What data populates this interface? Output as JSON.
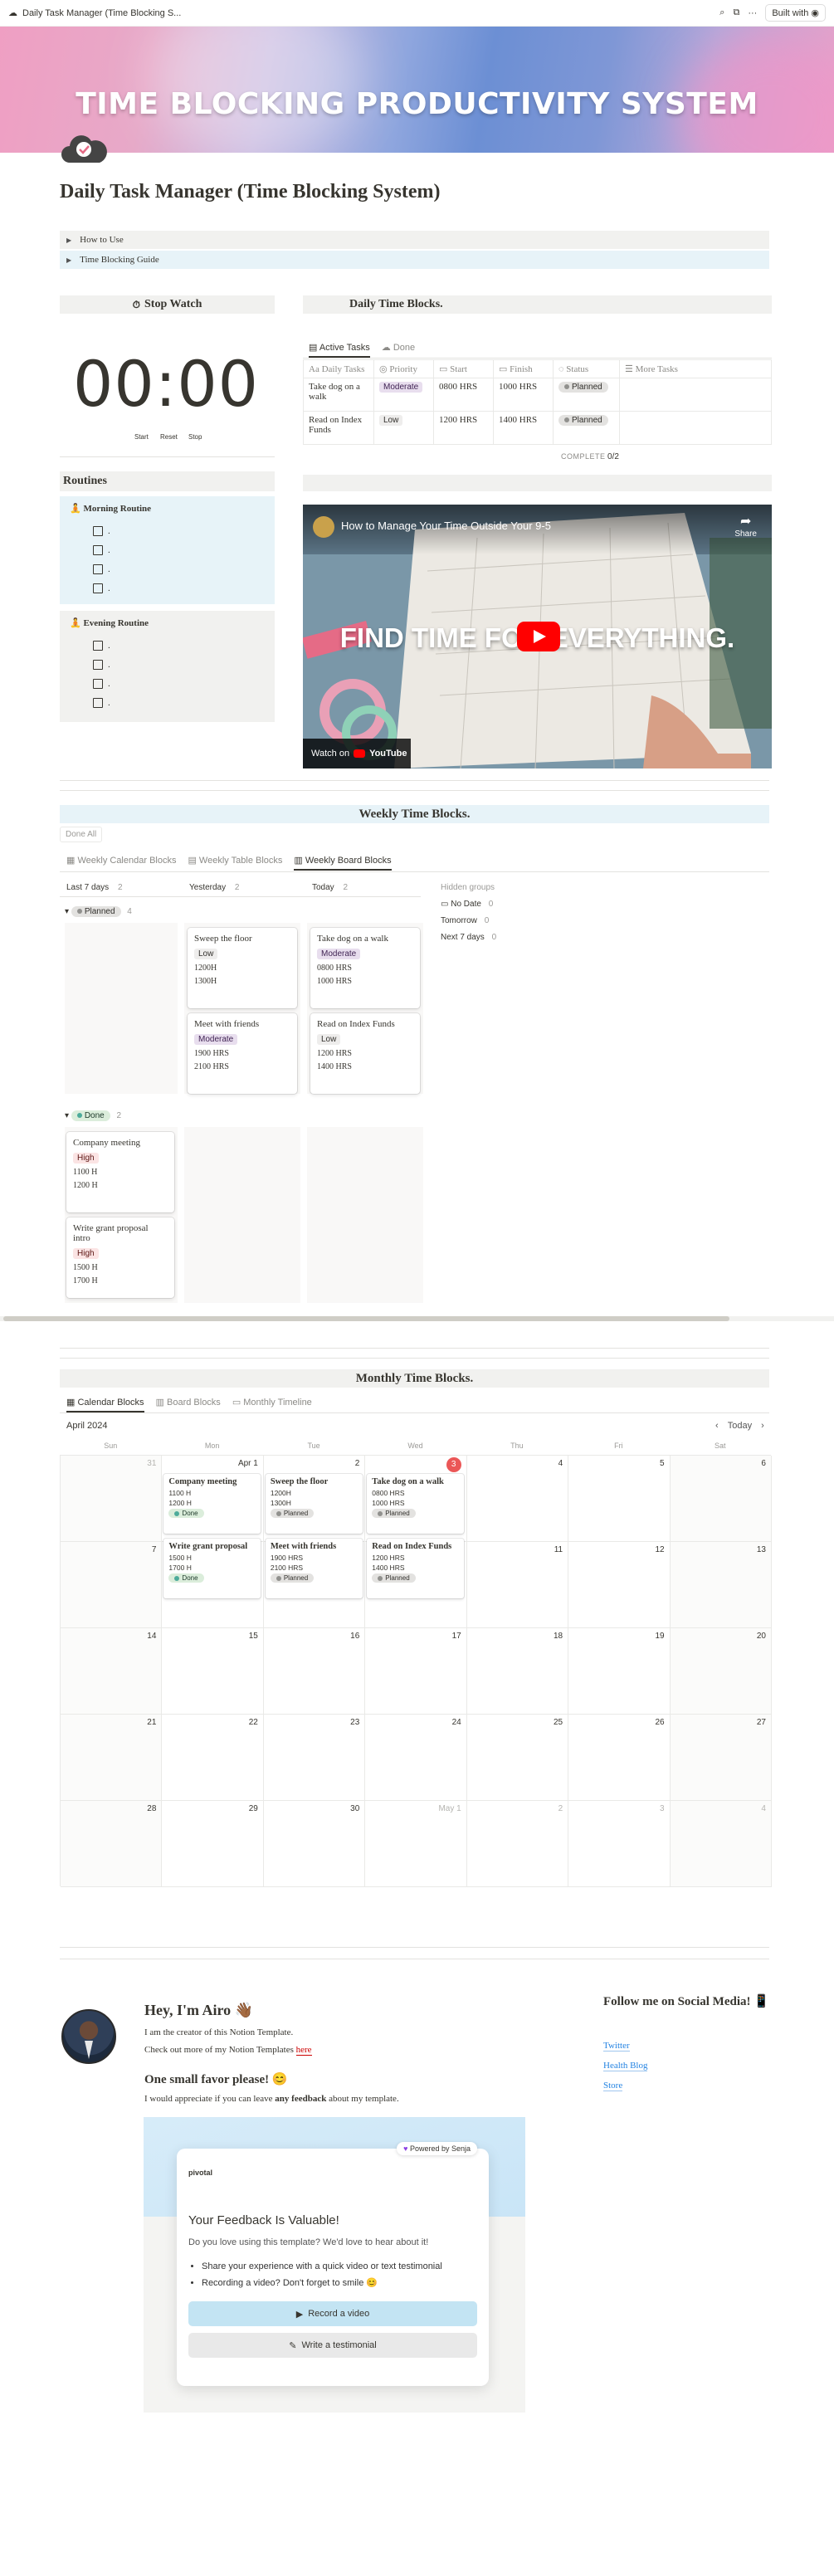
{
  "topbar": {
    "tab_title": "Daily Task Manager (Time Blocking S...",
    "built_with": "Built with"
  },
  "cover": {
    "title": "TIME BLOCKING PRODUCTIVITY SYSTEM"
  },
  "page": {
    "title": "Daily Task Manager (Time Blocking System)"
  },
  "toggles": [
    "How to Use",
    "Time Blocking Guide"
  ],
  "stopwatch": {
    "header": "Stop Watch",
    "time": "00:00",
    "start": "Start",
    "reset": "Reset",
    "stop": "Stop"
  },
  "daily": {
    "header": "Daily Time Blocks.",
    "tab_active": "Active Tasks",
    "tab_done": "Done",
    "columns": [
      "Daily Tasks",
      "Priority",
      "Start",
      "Finish",
      "Status",
      "More Tasks"
    ],
    "rows": [
      {
        "task": "Take dog on a walk",
        "priority": "Moderate",
        "start": "0800 HRS",
        "finish": "1000 HRS",
        "status": "Planned"
      },
      {
        "task": "Read on Index Funds",
        "priority": "Low",
        "start": "1200 HRS",
        "finish": "1400 HRS",
        "status": "Planned"
      }
    ],
    "count_label": "COMPLETE",
    "count_value": "0/2"
  },
  "routines": {
    "header": "Routines",
    "morning": "Morning Routine",
    "evening": "Evening Routine",
    "placeholder": "."
  },
  "video": {
    "title": "How to Manage Your Time Outside Your 9-5",
    "share": "Share",
    "overlay": "FIND TIME FOR EVERYTHING.",
    "watch_on": "Watch on",
    "youtube": "YouTube"
  },
  "weekly": {
    "header": "Weekly Time Blocks.",
    "done_all": "Done All",
    "tabs": [
      "Weekly Calendar Blocks",
      "Weekly Table Blocks",
      "Weekly Board Blocks"
    ],
    "columns": [
      {
        "label": "Last 7 days",
        "count": "2"
      },
      {
        "label": "Yesterday",
        "count": "2"
      },
      {
        "label": "Today",
        "count": "2"
      }
    ],
    "hidden": {
      "title": "Hidden groups",
      "items": [
        {
          "label": "No Date",
          "count": "0"
        },
        {
          "label": "Tomorrow",
          "count": "0"
        },
        {
          "label": "Next 7 days",
          "count": "0"
        }
      ]
    },
    "group_planned": {
      "label": "Planned",
      "count": "4"
    },
    "group_done": {
      "label": "Done",
      "count": "2"
    },
    "cards_planned": [
      {
        "name": "Sweep the floor",
        "priority": "Low",
        "start": "1200H",
        "finish": "1300H"
      },
      {
        "name": "Meet with friends",
        "priority": "Moderate",
        "start": "1900 HRS",
        "finish": "2100 HRS"
      },
      {
        "name": "Take dog on a walk",
        "priority": "Moderate",
        "start": "0800 HRS",
        "finish": "1000 HRS"
      },
      {
        "name": "Read on Index Funds",
        "priority": "Low",
        "start": "1200 HRS",
        "finish": "1400 HRS"
      }
    ],
    "cards_done": [
      {
        "name": "Company meeting",
        "priority": "High",
        "start": "1100 H",
        "finish": "1200 H"
      },
      {
        "name": "Write grant proposal intro",
        "priority": "High",
        "start": "1500 H",
        "finish": "1700 H"
      }
    ]
  },
  "monthly": {
    "header": "Monthly Time Blocks.",
    "tabs": [
      "Calendar Blocks",
      "Board Blocks",
      "Monthly Timeline"
    ],
    "month": "April 2024",
    "today": "Today",
    "weekdays": [
      "Sun",
      "Mon",
      "Tue",
      "Wed",
      "Thu",
      "Fri",
      "Sat"
    ],
    "days": [
      "31",
      "Apr 1",
      "2",
      "3",
      "4",
      "5",
      "6",
      "7",
      "8",
      "9",
      "10",
      "11",
      "12",
      "13",
      "14",
      "15",
      "16",
      "17",
      "18",
      "19",
      "20",
      "21",
      "22",
      "23",
      "24",
      "25",
      "26",
      "27",
      "28",
      "29",
      "30",
      "May 1",
      "2",
      "3",
      "4"
    ],
    "events": [
      {
        "name": "Company meeting",
        "a": "1100 H",
        "b": "1200 H",
        "status": "Done"
      },
      {
        "name": "Write grant proposal",
        "a": "1500 H",
        "b": "1700 H",
        "status": "Done"
      },
      {
        "name": "Sweep the floor",
        "a": "1200H",
        "b": "1300H",
        "status": "Planned"
      },
      {
        "name": "Meet with friends",
        "a": "1900 HRS",
        "b": "2100 HRS",
        "status": "Planned"
      },
      {
        "name": "Take dog on a walk",
        "a": "0800 HRS",
        "b": "1000 HRS",
        "status": "Planned"
      },
      {
        "name": "Read on Index Funds",
        "a": "1200 HRS",
        "b": "1400 HRS",
        "status": "Planned"
      }
    ]
  },
  "creator": {
    "greeting": "Hey, I'm Airo 👋🏾",
    "line1": "I am the creator of this Notion Template.",
    "line2": "Check out more of my Notion Templates ",
    "link": "here",
    "favor": "One small favor please! 😊",
    "favor_text_1": "I would appreciate if you can leave ",
    "favor_bold": "any feedback",
    "favor_text_2": " about my template."
  },
  "social": {
    "title": "Follow me on Social Media! 📱",
    "links": [
      "Twitter",
      "Health Blog",
      "Store"
    ]
  },
  "feedback": {
    "powered": "Powered by Senja",
    "logo": "pivotal",
    "title": "Your Feedback Is Valuable!",
    "subtitle": "Do you love using this template? We'd love to hear about it!",
    "bullets": [
      "Share your experience with a quick video or text testimonial",
      "Recording a video? Don't forget to smile 😊"
    ],
    "record": "Record a video",
    "write": "Write a testimonial"
  },
  "colors": {
    "accent": "#2383e2",
    "today_red": "#eb5757",
    "blue_bg": "#e7f3f8",
    "gray_bg": "#f1f1ef"
  }
}
